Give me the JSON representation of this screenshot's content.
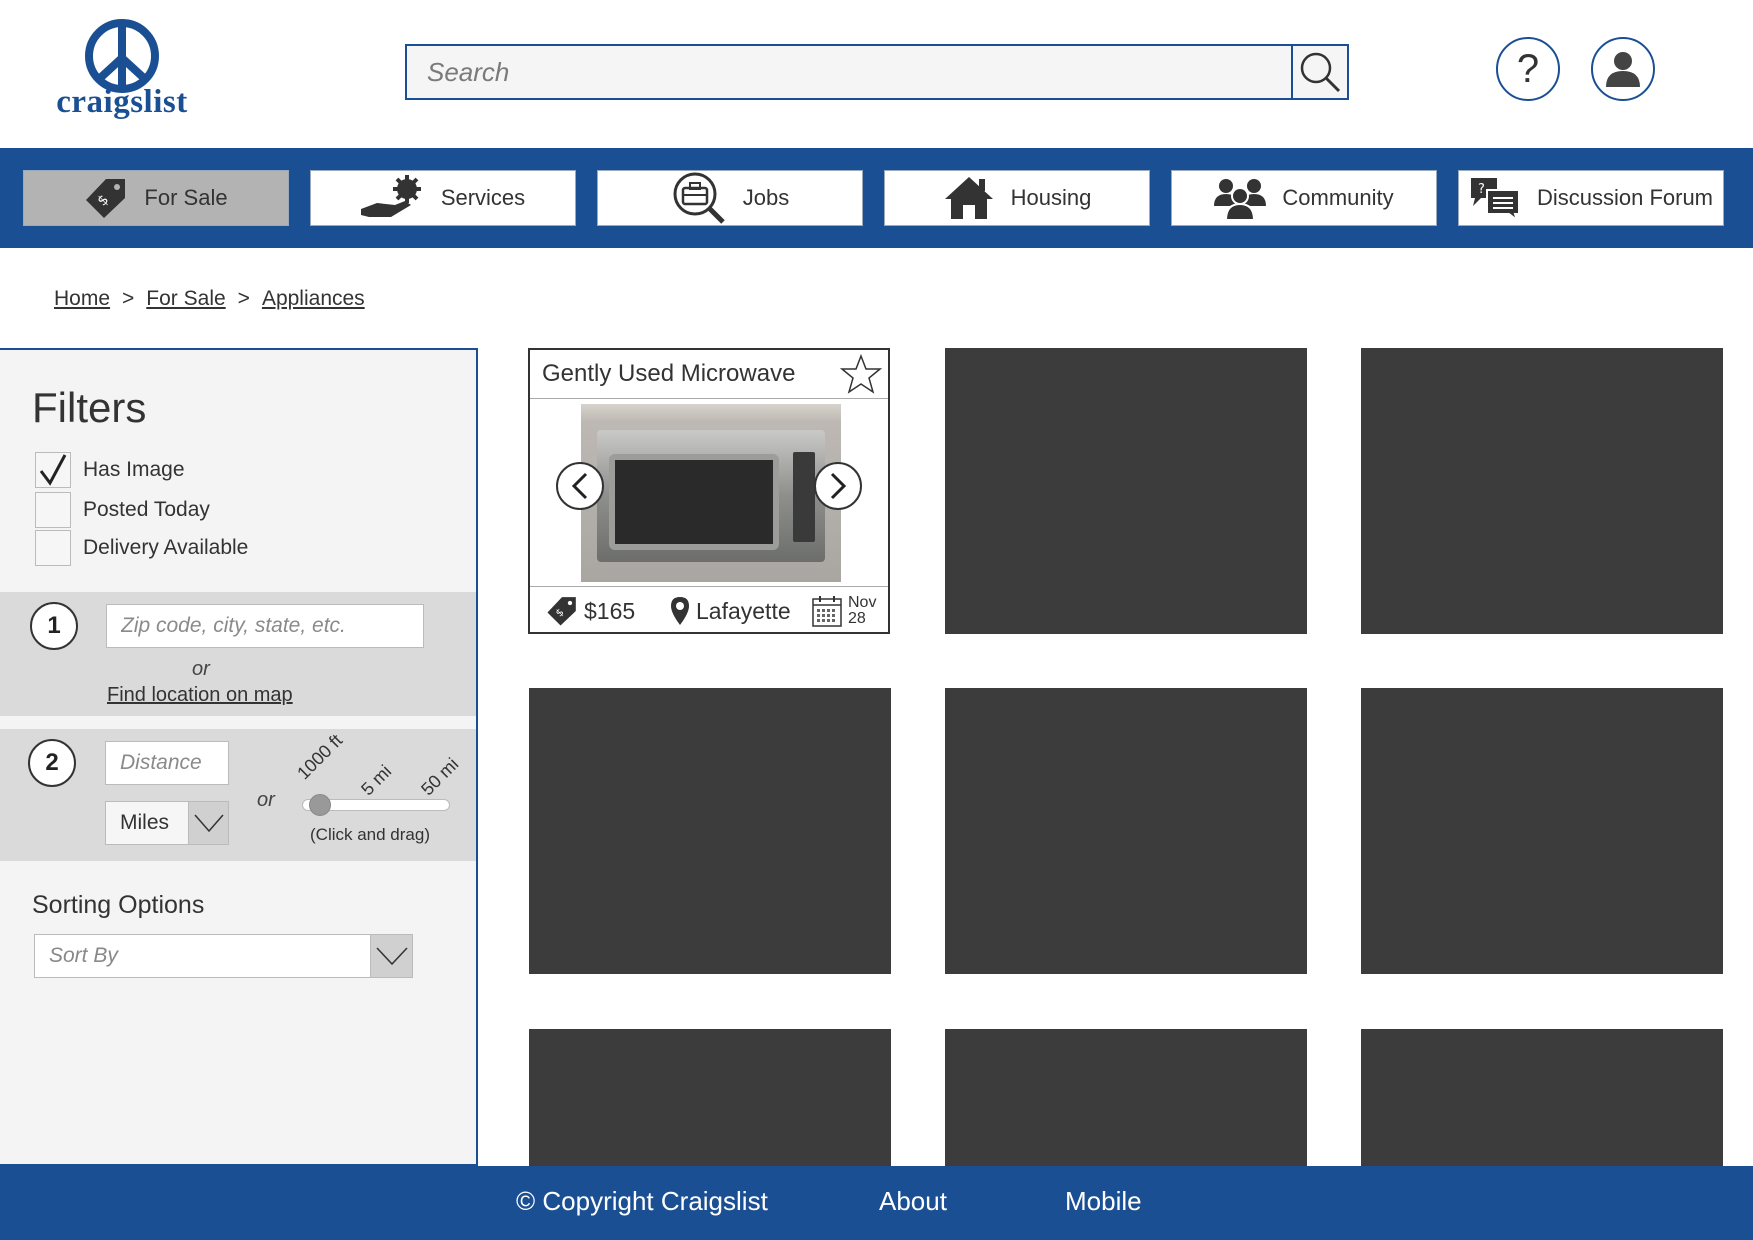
{
  "header": {
    "logo_text": "craigslist",
    "search_placeholder": "Search",
    "help_label": "?"
  },
  "nav": {
    "items": [
      {
        "label": "For Sale",
        "icon": "price-tag-icon",
        "active": true
      },
      {
        "label": "Services",
        "icon": "hand-gear-icon",
        "active": false
      },
      {
        "label": "Jobs",
        "icon": "briefcase-search-icon",
        "active": false
      },
      {
        "label": "Housing",
        "icon": "house-icon",
        "active": false
      },
      {
        "label": "Community",
        "icon": "people-icon",
        "active": false
      },
      {
        "label": "Discussion Forum",
        "icon": "chat-bubbles-icon",
        "active": false
      }
    ]
  },
  "breadcrumb": {
    "items": [
      "Home",
      "For Sale",
      "Appliances"
    ],
    "separator": ">"
  },
  "filters": {
    "title": "Filters",
    "checkboxes": [
      {
        "label": "Has Image",
        "checked": true
      },
      {
        "label": "Posted Today",
        "checked": false
      },
      {
        "label": "Delivery Available",
        "checked": false
      }
    ],
    "location": {
      "step": "1",
      "placeholder": "Zip code, city, state, etc.",
      "or": "or",
      "map_link": "Find location on map"
    },
    "distance": {
      "step": "2",
      "placeholder": "Distance",
      "unit": "Miles",
      "or": "or",
      "ticks": [
        "1000 ft",
        "5 mi",
        "50 mi"
      ],
      "slider_value_fraction": 0,
      "hint": "(Click and drag)"
    },
    "sorting": {
      "title": "Sorting Options",
      "placeholder": "Sort By"
    }
  },
  "listing": {
    "title": "Gently Used Microwave",
    "price": "$165",
    "location": "Lafayette",
    "date_month": "Nov",
    "date_day": "28"
  },
  "footer": {
    "copyright": "© Copyright Craigslist",
    "about": "About",
    "mobile": "Mobile"
  },
  "colors": {
    "brand_blue": "#1b4f93",
    "placeholder_card": "#3c3c3c",
    "active_nav": "#b3b3b3"
  }
}
